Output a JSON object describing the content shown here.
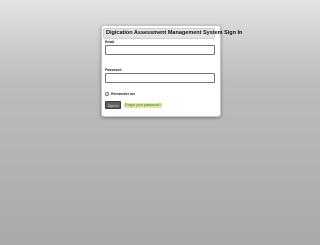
{
  "signin": {
    "title": "Digication Assessment Management System Sign In",
    "email_label": "Email",
    "email_value": "",
    "password_label": "Password",
    "password_value": "",
    "remember_label": "Remember me",
    "signin_button": "Sign In",
    "forgot_link": "Forgot your password?"
  }
}
